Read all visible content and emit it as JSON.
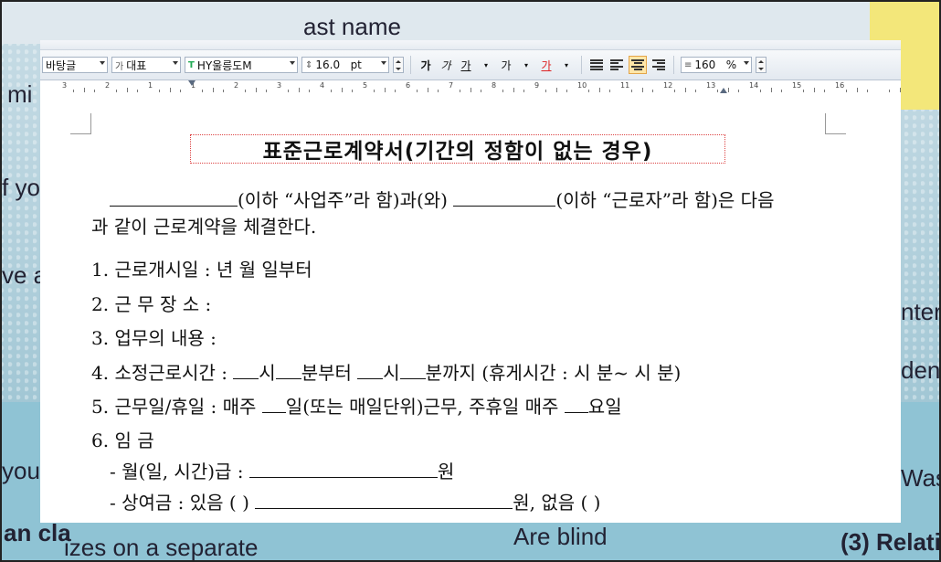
{
  "background": {
    "words": [
      "ast name",
      "mi",
      "f yo",
      "ve a",
      "nter",
      "den",
      "you",
      "Was",
      "an cla",
      "izes on a separate",
      "Are blind",
      "(3) Relati"
    ]
  },
  "toolbar": {
    "style_combo": "바탕글",
    "lang_combo": "대표",
    "font_combo": "HY울릉도M",
    "size_value": "16.0",
    "size_unit": "pt",
    "bold": "가",
    "italic": "가",
    "underline": "가",
    "strike": "가",
    "color": "가",
    "line_spacing_value": "160",
    "line_spacing_unit": "%"
  },
  "ruler": {
    "numbers": [
      "3",
      "2",
      "1",
      "1",
      "2",
      "3",
      "4",
      "5",
      "6",
      "7",
      "8",
      "9",
      "10",
      "11",
      "12",
      "13",
      "14",
      "15",
      "16"
    ]
  },
  "document": {
    "title": "표준근로계약서(기간의 정함이 없는 경우)",
    "intro_1a": "(이하 “사업주”라 함)과(와) ",
    "intro_1b": "(이하 “근로자”라 함)은 다음",
    "intro_2": "과 같이 근로계약을 체결한다.",
    "item1": "1. 근로개시일 :        년    월    일부터",
    "item2": "2. 근 무 장 소 :",
    "item3": "3. 업무의 내용 :",
    "item4a": "4. 소정근로시간 : ",
    "item4b": "시",
    "item4c": "분부터 ",
    "item4d": "시",
    "item4e": "분까지 (휴게시간 :  시  분~  시   분)",
    "item5a": "5. 근무일/휴일 : 매주 ",
    "item5b": "일(또는 매일단위)근무, 주휴일 매주 ",
    "item5c": "요일",
    "item6": "6. 임    금",
    "wage_a": "- 월(일, 시간)급 : ",
    "wage_b": "원",
    "bonus_a": "- 상여금 : 있음 (      ) ",
    "bonus_b": "원,   없음 (       )"
  }
}
